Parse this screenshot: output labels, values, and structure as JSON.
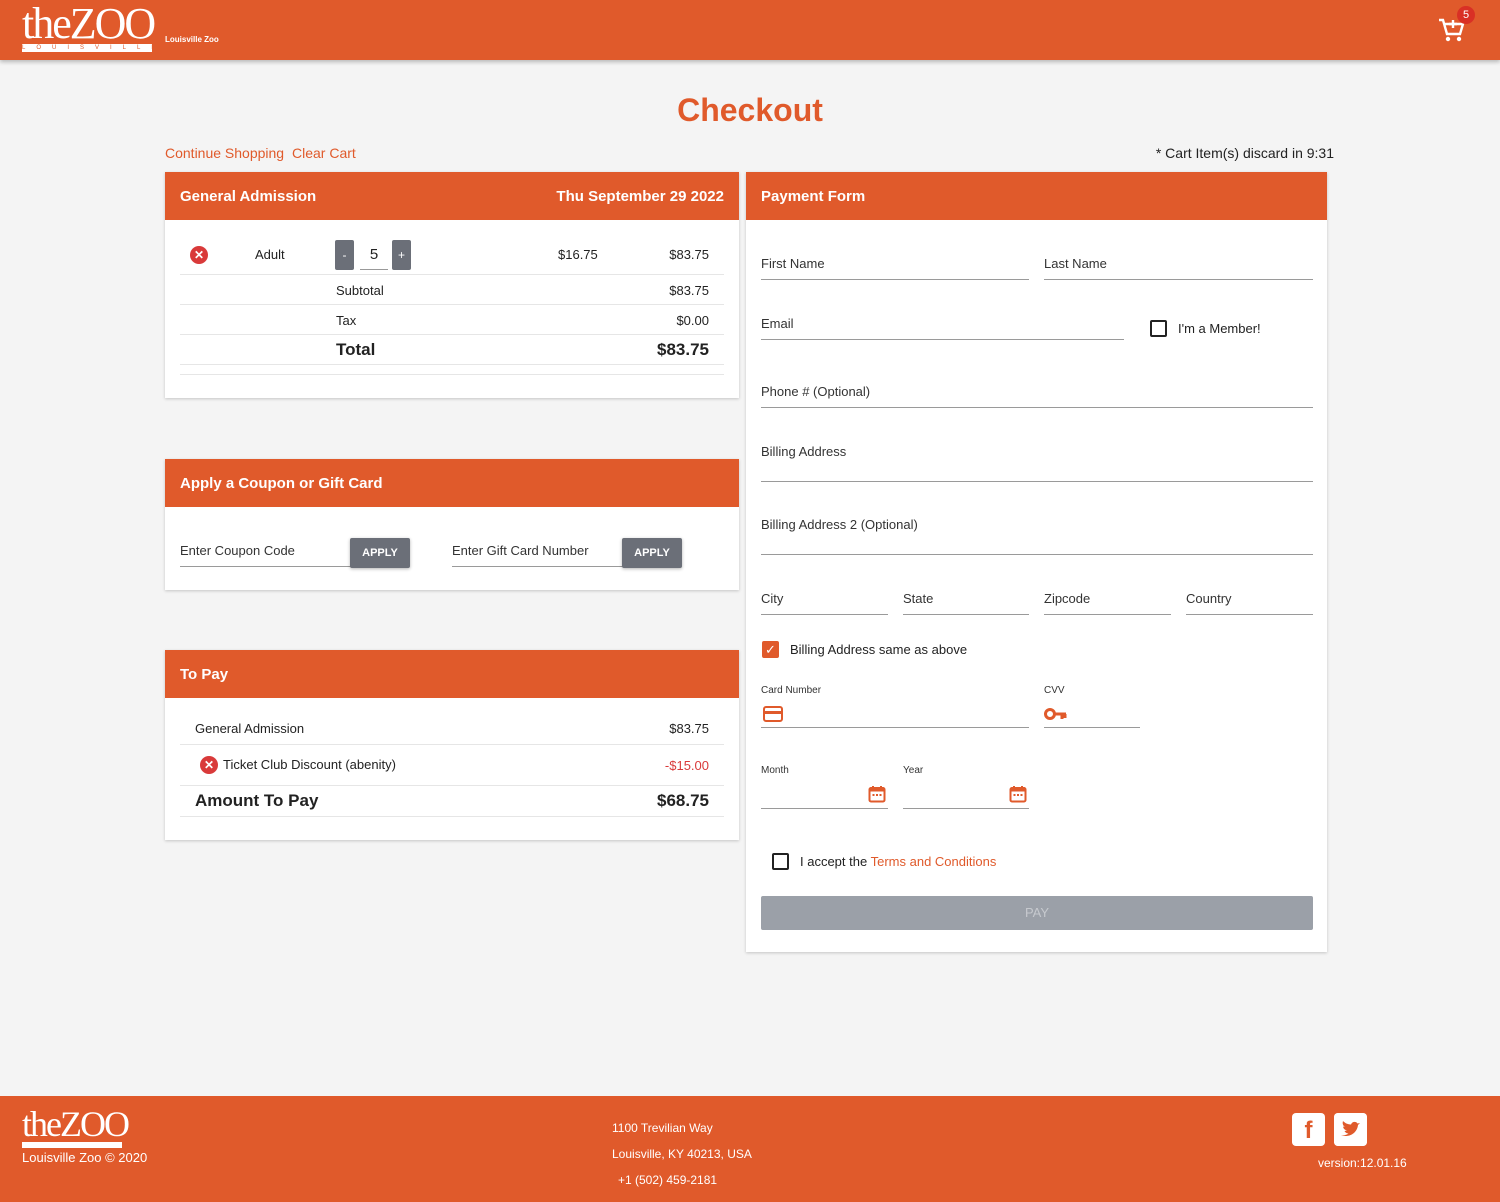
{
  "header": {
    "logo_text": "theZOO",
    "logo_sub": "LOUISVILLE",
    "site_name": "Louisville Zoo",
    "cart_count": "5",
    "cart_icon": "cart-icon"
  },
  "page": {
    "title": "Checkout",
    "continue_label": "Continue Shopping",
    "clear_label": "Clear Cart",
    "timer_text": "* Cart Item(s) discard in 9:31"
  },
  "admission": {
    "title": "General Admission",
    "date": "Thu September 29 2022",
    "item": {
      "name": "Adult",
      "qty": "5",
      "minus": "-",
      "plus": "+",
      "unit_price": "$16.75",
      "line_total": "$83.75"
    },
    "subtotal_label": "Subtotal",
    "subtotal": "$83.75",
    "tax_label": "Tax",
    "tax": "$0.00",
    "total_label": "Total",
    "total": "$83.75"
  },
  "coupon": {
    "title": "Apply a Coupon or Gift Card",
    "coupon_placeholder": "Enter Coupon Code",
    "gift_placeholder": "Enter Gift Card Number",
    "apply_label": "APPLY"
  },
  "topay": {
    "title": "To Pay",
    "admission_label": "General Admission",
    "admission_amount": "$83.75",
    "discount_label": "Ticket Club Discount (abenity)",
    "discount_amount": "-$15.00",
    "amount_label": "Amount To Pay",
    "amount": "$68.75"
  },
  "payment": {
    "title": "Payment Form",
    "first_name": "First Name",
    "last_name": "Last Name",
    "email": "Email",
    "member_label": "I'm a Member!",
    "phone": "Phone # (Optional)",
    "billing1": "Billing Address",
    "billing2": "Billing Address 2 (Optional)",
    "city": "City",
    "state": "State",
    "zip": "Zipcode",
    "country": "Country",
    "same_label": "Billing Address same as above",
    "card_number": "Card Number",
    "cvv": "CVV",
    "month": "Month",
    "year": "Year",
    "terms_prefix": "I accept the",
    "terms_link": "Terms and Conditions",
    "pay_label": "PAY"
  },
  "footer": {
    "logo_text": "theZOO",
    "copyright": "Louisville Zoo © 2020",
    "address1": "1100 Trevilian Way",
    "address2": "Louisville, KY 40213, USA",
    "phone": "+1 (502) 459-2181",
    "version": "version:12.01.16"
  },
  "colors": {
    "brand": "#e05a2b",
    "danger": "#d93a3a",
    "button_gray": "#6b6f78"
  }
}
